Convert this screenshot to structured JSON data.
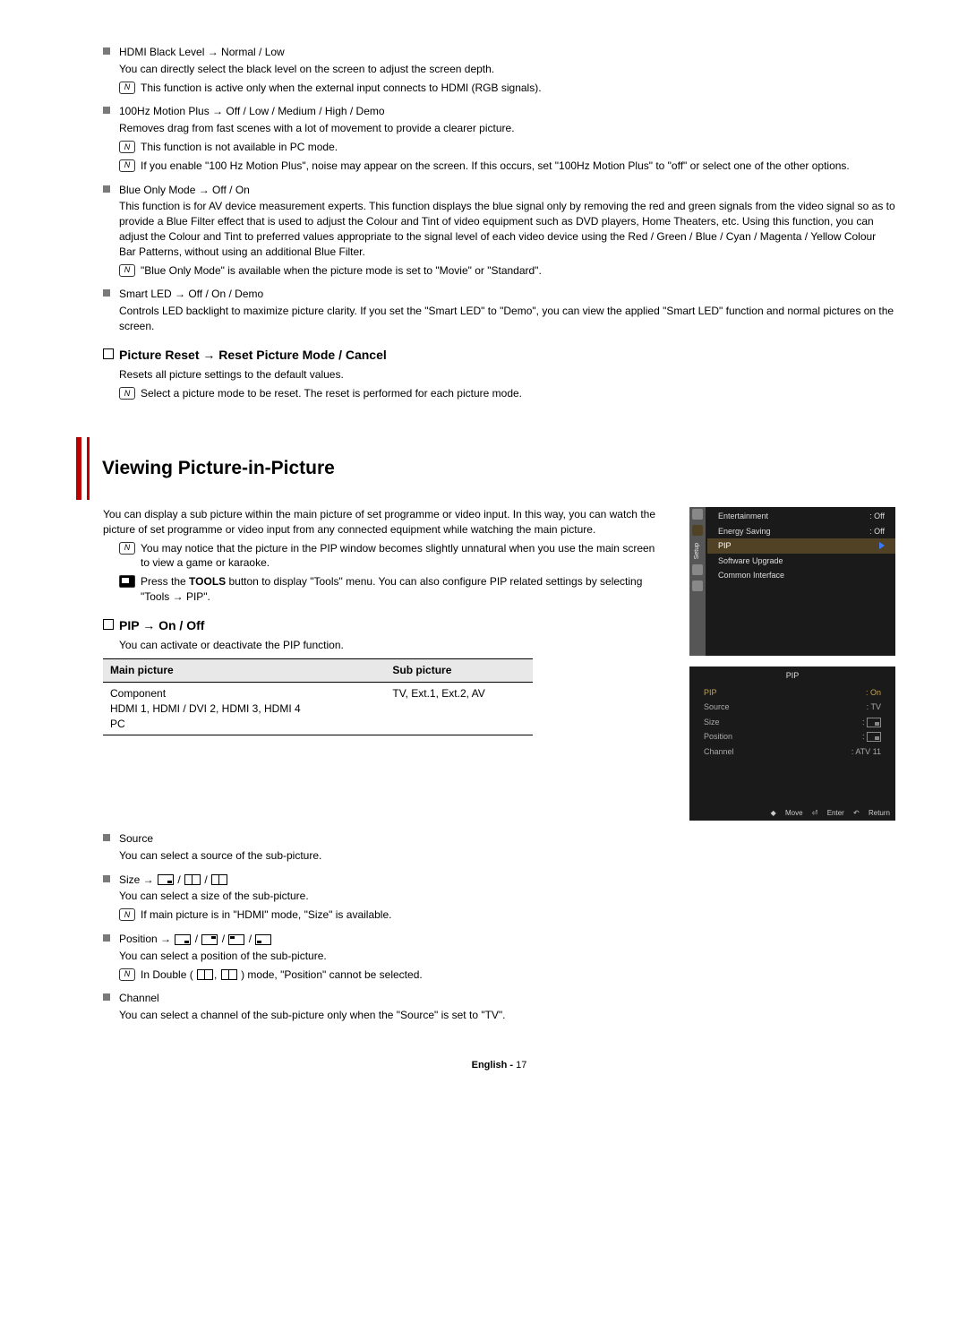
{
  "items": {
    "hdmi": {
      "title": "HDMI Black Level → Normal / Low",
      "desc": "You can directly select the black level on the screen to adjust the screen depth.",
      "note1": "This function is active only when the external input connects to HDMI (RGB signals)."
    },
    "motion": {
      "title": "100Hz Motion Plus → Off / Low / Medium / High / Demo",
      "desc": "Removes drag from fast scenes with a lot of movement to provide a clearer picture.",
      "note1": "This function is not available in PC mode.",
      "note2": "If you enable \"100 Hz Motion Plus\", noise may appear on the screen. If this occurs, set \"100Hz Motion Plus\" to \"off\" or select one of the other options."
    },
    "blue": {
      "title": "Blue Only Mode → Off / On",
      "desc": "This function is for AV device measurement experts. This function displays the blue signal only by removing the red and green signals from the video signal so as to provide a Blue Filter effect that is used to adjust the Colour and Tint of video equipment such as DVD players, Home Theaters, etc. Using this function, you can adjust the Colour and Tint to preferred values appropriate to the signal level of each video device using the Red / Green / Blue / Cyan / Magenta / Yellow Colour Bar Patterns, without using an additional Blue Filter.",
      "note1": "\"Blue Only Mode\" is available when the picture mode is set to \"Movie\" or \"Standard\"."
    },
    "smart": {
      "title": "Smart LED → Off / On / Demo",
      "desc": "Controls LED backlight to maximize picture clarity. If you set the \"Smart LED\" to \"Demo\", you can view the applied \"Smart LED\" function and normal pictures on the screen."
    }
  },
  "reset": {
    "head": "Picture Reset → Reset Picture Mode / Cancel",
    "desc": "Resets all picture settings to the default values.",
    "note": "Select a picture mode to be reset. The reset is performed for each picture mode."
  },
  "pip": {
    "title": "Viewing Picture-in-Picture",
    "intro": "You can display a sub picture within the main picture of set programme or video input. In this way, you can watch the picture of set programme or video input from any connected equipment while watching the main picture.",
    "note1": "You may notice that the picture in the PIP window becomes slightly unnatural when you use the main screen to view a game or karaoke.",
    "tool_pre": "Press the ",
    "tool_bold": "TOOLS",
    "tool_post": " button to display \"Tools\" menu. You can also configure PIP related settings by selecting \"Tools → PIP\".",
    "onoff": {
      "head": "PIP → On / Off",
      "desc": "You can activate or deactivate the PIP function."
    },
    "table": {
      "h1": "Main picture",
      "h2": "Sub picture",
      "r1a": "Component",
      "r1b": "HDMI 1, HDMI / DVI 2, HDMI 3, HDMI 4",
      "r1c": "PC",
      "r2": "TV, Ext.1, Ext.2, AV"
    },
    "source": {
      "t": "Source",
      "d": "You can select a source of the sub-picture."
    },
    "size": {
      "t": "Size → ",
      "d": "You can select a size of the sub-picture.",
      "n": "If main picture is in \"HDMI\" mode, \"Size\" is available."
    },
    "position": {
      "t": "Position → ",
      "d": "You can select a position of the sub-picture.",
      "n_pre": "In Double ( ",
      "n_post": " ) mode, \"Position\" cannot be selected."
    },
    "channel": {
      "t": "Channel",
      "d": "You can select a channel of the sub-picture only when the \"Source\" is set to \"TV\"."
    }
  },
  "osd1": {
    "setup": "Setup",
    "r1": {
      "l": "Entertainment",
      "v": ": Off"
    },
    "r2": {
      "l": "Energy Saving",
      "v": ": Off"
    },
    "r3": {
      "l": "PIP"
    },
    "r4": {
      "l": "Software Upgrade"
    },
    "r5": {
      "l": "Common Interface"
    }
  },
  "osd2": {
    "title": "PIP",
    "r1": {
      "l": "PIP",
      "v": ": On"
    },
    "r2": {
      "l": "Source",
      "v": ": TV"
    },
    "r3": {
      "l": "Size",
      "v": ":"
    },
    "r4": {
      "l": "Position",
      "v": ":"
    },
    "r5": {
      "l": "Channel",
      "v": ": ATV 11"
    },
    "f1": "Move",
    "f2": "Enter",
    "f3": "Return"
  },
  "footer": {
    "lang": "English - ",
    "page": "17"
  }
}
